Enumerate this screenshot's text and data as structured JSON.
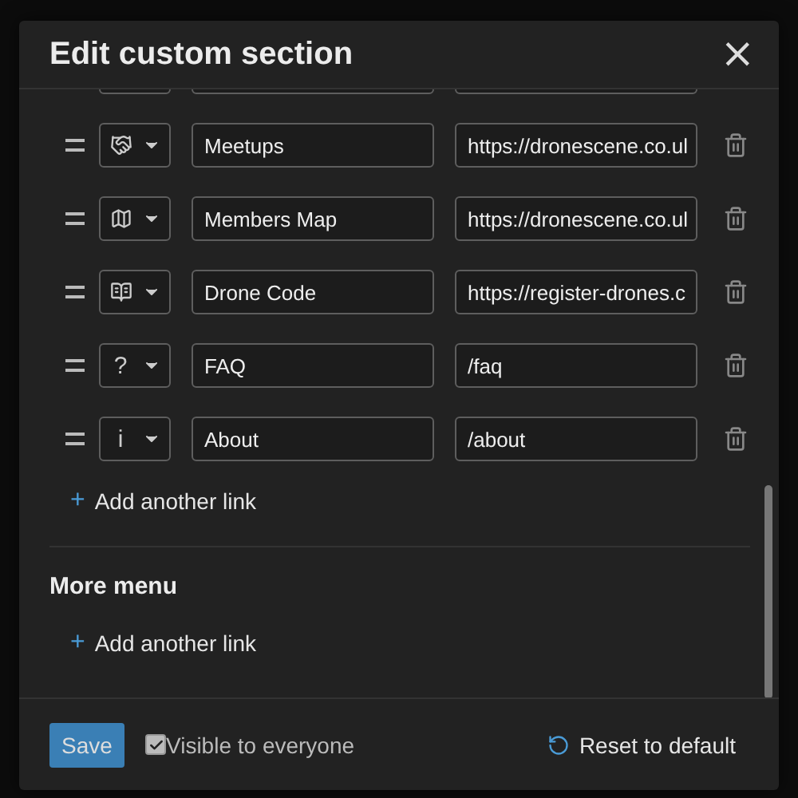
{
  "dialog": {
    "title": "Edit custom section",
    "close": "×"
  },
  "links": [
    {
      "kind": "handshake",
      "title": "Meetups",
      "url": "https://dronescene.co.ul"
    },
    {
      "kind": "map",
      "title": "Members Map",
      "url": "https://dronescene.co.ul"
    },
    {
      "kind": "reader",
      "title": "Drone Code",
      "url": "https://register-drones.c"
    },
    {
      "kind": "glyph",
      "glyph": "?",
      "title": "FAQ",
      "url": "/faq"
    },
    {
      "kind": "glyph",
      "glyph": "i",
      "title": "About",
      "url": "/about"
    }
  ],
  "add_link": {
    "plus": "+",
    "label": "Add another link"
  },
  "more_menu": {
    "title": "More menu",
    "add_link": {
      "plus": "+",
      "label": "Add another link"
    }
  },
  "footer": {
    "save": "Save",
    "visible": {
      "label": "Visible to everyone",
      "checked": true
    },
    "reset": "Reset to default"
  }
}
